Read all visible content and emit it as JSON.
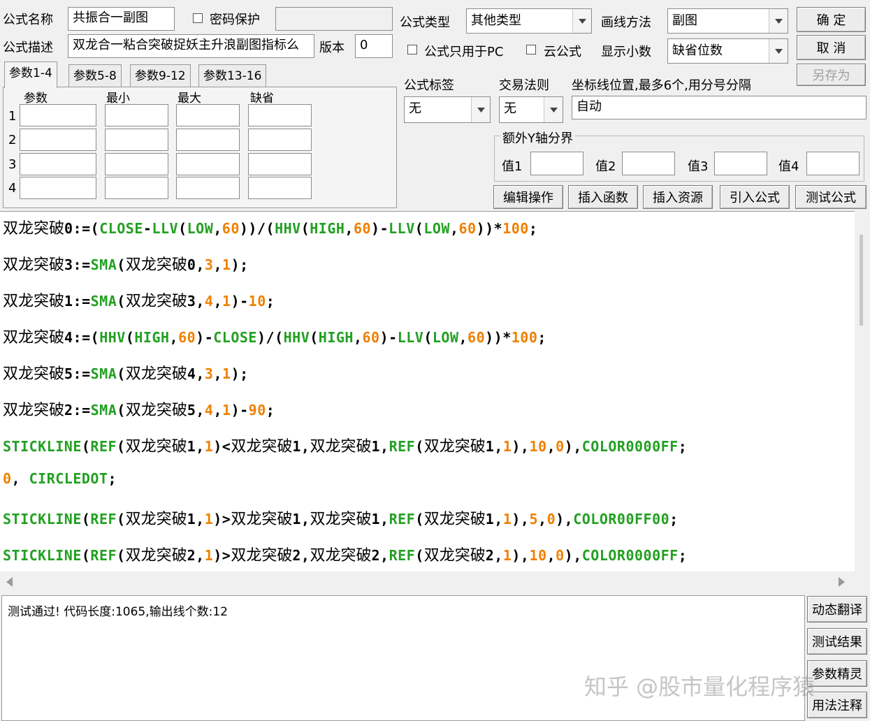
{
  "header": {
    "name_label": "公式名称",
    "name_value": "共振合一副图",
    "password_label": "密码保护",
    "desc_label": "公式描述",
    "desc_value": "双龙合一粘合突破捉妖主升浪副图指标么",
    "version_label": "版本",
    "version_value": "0",
    "type_label": "公式类型",
    "type_value": "其他类型",
    "draw_label": "画线方法",
    "draw_value": "副图",
    "pc_only_label": "公式只用于PC",
    "cloud_label": "云公式",
    "decimals_label": "显示小数",
    "decimals_value": "缺省位数"
  },
  "buttons": {
    "ok": "确  定",
    "cancel": "取  消",
    "save_as": "另存为"
  },
  "tabs": [
    "参数1-4",
    "参数5-8",
    "参数9-12",
    "参数13-16"
  ],
  "params": {
    "headers": [
      "参数",
      "最小",
      "最大",
      "缺省"
    ],
    "rows": [
      "1",
      "2",
      "3",
      "4"
    ]
  },
  "options": {
    "tag_label": "公式标签",
    "tag_value": "无",
    "trade_label": "交易法则",
    "trade_value": "无",
    "coord_label": "坐标线位置,最多6个,用分号分隔",
    "coord_value": "自动",
    "extra_y_label": "额外Y轴分界",
    "val1": "值1",
    "val2": "值2",
    "val3": "值3",
    "val4": "值4"
  },
  "toolbar": [
    "编辑操作",
    "插入函数",
    "插入资源",
    "引入公式",
    "测试公式"
  ],
  "code_lines": [
    [
      [
        "cn",
        "双龙突破"
      ],
      [
        "t",
        "0:=("
      ],
      [
        "f",
        "CLOSE"
      ],
      [
        "t",
        "-"
      ],
      [
        "f",
        "LLV"
      ],
      [
        "t",
        "("
      ],
      [
        "f",
        "LOW"
      ],
      [
        "t",
        ","
      ],
      [
        "n",
        "60"
      ],
      [
        "t",
        "))/("
      ],
      [
        "f",
        "HHV"
      ],
      [
        "t",
        "("
      ],
      [
        "f",
        "HIGH"
      ],
      [
        "t",
        ","
      ],
      [
        "n",
        "60"
      ],
      [
        "t",
        ")-"
      ],
      [
        "f",
        "LLV"
      ],
      [
        "t",
        "("
      ],
      [
        "f",
        "LOW"
      ],
      [
        "t",
        ","
      ],
      [
        "n",
        "60"
      ],
      [
        "t",
        "))*"
      ],
      [
        "n",
        "100"
      ],
      [
        "t",
        ";"
      ]
    ],
    [
      [
        "cn",
        "双龙突破"
      ],
      [
        "t",
        "3:="
      ],
      [
        "f",
        "SMA"
      ],
      [
        "t",
        "("
      ],
      [
        "cn",
        "双龙突破"
      ],
      [
        "t",
        "0,"
      ],
      [
        "n",
        "3"
      ],
      [
        "t",
        ","
      ],
      [
        "n",
        "1"
      ],
      [
        "t",
        ");"
      ]
    ],
    [
      [
        "cn",
        "双龙突破"
      ],
      [
        "t",
        "1:="
      ],
      [
        "f",
        "SMA"
      ],
      [
        "t",
        "("
      ],
      [
        "cn",
        "双龙突破"
      ],
      [
        "t",
        "3,"
      ],
      [
        "n",
        "4"
      ],
      [
        "t",
        ","
      ],
      [
        "n",
        "1"
      ],
      [
        "t",
        ")-"
      ],
      [
        "n",
        "10"
      ],
      [
        "t",
        ";"
      ]
    ],
    [
      [
        "cn",
        "双龙突破"
      ],
      [
        "t",
        "4:=("
      ],
      [
        "f",
        "HHV"
      ],
      [
        "t",
        "("
      ],
      [
        "f",
        "HIGH"
      ],
      [
        "t",
        ","
      ],
      [
        "n",
        "60"
      ],
      [
        "t",
        ")-"
      ],
      [
        "f",
        "CLOSE"
      ],
      [
        "t",
        ")/("
      ],
      [
        "f",
        "HHV"
      ],
      [
        "t",
        "("
      ],
      [
        "f",
        "HIGH"
      ],
      [
        "t",
        ","
      ],
      [
        "n",
        "60"
      ],
      [
        "t",
        ")-"
      ],
      [
        "f",
        "LLV"
      ],
      [
        "t",
        "("
      ],
      [
        "f",
        "LOW"
      ],
      [
        "t",
        ","
      ],
      [
        "n",
        "60"
      ],
      [
        "t",
        "))*"
      ],
      [
        "n",
        "100"
      ],
      [
        "t",
        ";"
      ]
    ],
    [
      [
        "cn",
        "双龙突破"
      ],
      [
        "t",
        "5:="
      ],
      [
        "f",
        "SMA"
      ],
      [
        "t",
        "("
      ],
      [
        "cn",
        "双龙突破"
      ],
      [
        "t",
        "4,"
      ],
      [
        "n",
        "3"
      ],
      [
        "t",
        ","
      ],
      [
        "n",
        "1"
      ],
      [
        "t",
        ");"
      ]
    ],
    [
      [
        "cn",
        "双龙突破"
      ],
      [
        "t",
        "2:="
      ],
      [
        "f",
        "SMA"
      ],
      [
        "t",
        "("
      ],
      [
        "cn",
        "双龙突破"
      ],
      [
        "t",
        "5,"
      ],
      [
        "n",
        "4"
      ],
      [
        "t",
        ","
      ],
      [
        "n",
        "1"
      ],
      [
        "t",
        ")-"
      ],
      [
        "n",
        "90"
      ],
      [
        "t",
        ";"
      ]
    ],
    [
      [
        "f",
        "STICKLINE"
      ],
      [
        "t",
        "("
      ],
      [
        "f",
        "REF"
      ],
      [
        "t",
        "("
      ],
      [
        "cn",
        "双龙突破"
      ],
      [
        "t",
        "1,"
      ],
      [
        "n",
        "1"
      ],
      [
        "t",
        ")<"
      ],
      [
        "cn",
        "双龙突破"
      ],
      [
        "t",
        "1,"
      ],
      [
        "cn",
        "双龙突破"
      ],
      [
        "t",
        "1,"
      ],
      [
        "f",
        "REF"
      ],
      [
        "t",
        "("
      ],
      [
        "cn",
        "双龙突破"
      ],
      [
        "t",
        "1,"
      ],
      [
        "n",
        "1"
      ],
      [
        "t",
        "),"
      ],
      [
        "n",
        "10"
      ],
      [
        "t",
        ","
      ],
      [
        "n",
        "0"
      ],
      [
        "t",
        "),"
      ],
      [
        "f",
        "COLOR0000FF"
      ],
      [
        "t",
        ";"
      ]
    ],
    [
      [
        "n",
        "0"
      ],
      [
        "t",
        ", "
      ],
      [
        "f",
        "CIRCLEDOT"
      ],
      [
        "t",
        ";"
      ]
    ],
    [
      [
        "f",
        "STICKLINE"
      ],
      [
        "t",
        "("
      ],
      [
        "f",
        "REF"
      ],
      [
        "t",
        "("
      ],
      [
        "cn",
        "双龙突破"
      ],
      [
        "t",
        "1,"
      ],
      [
        "n",
        "1"
      ],
      [
        "t",
        ")>"
      ],
      [
        "cn",
        "双龙突破"
      ],
      [
        "t",
        "1,"
      ],
      [
        "cn",
        "双龙突破"
      ],
      [
        "t",
        "1,"
      ],
      [
        "f",
        "REF"
      ],
      [
        "t",
        "("
      ],
      [
        "cn",
        "双龙突破"
      ],
      [
        "t",
        "1,"
      ],
      [
        "n",
        "1"
      ],
      [
        "t",
        "),"
      ],
      [
        "n",
        "5"
      ],
      [
        "t",
        ","
      ],
      [
        "n",
        "0"
      ],
      [
        "t",
        "),"
      ],
      [
        "f",
        "COLOR00FF00"
      ],
      [
        "t",
        ";"
      ]
    ],
    [
      [
        "f",
        "STICKLINE"
      ],
      [
        "t",
        "("
      ],
      [
        "f",
        "REF"
      ],
      [
        "t",
        "("
      ],
      [
        "cn",
        "双龙突破"
      ],
      [
        "t",
        "2,"
      ],
      [
        "n",
        "1"
      ],
      [
        "t",
        ")>"
      ],
      [
        "cn",
        "双龙突破"
      ],
      [
        "t",
        "2,"
      ],
      [
        "cn",
        "双龙突破"
      ],
      [
        "t",
        "2,"
      ],
      [
        "f",
        "REF"
      ],
      [
        "t",
        "("
      ],
      [
        "cn",
        "双龙突破"
      ],
      [
        "t",
        "2,"
      ],
      [
        "n",
        "1"
      ],
      [
        "t",
        "),"
      ],
      [
        "n",
        "10"
      ],
      [
        "t",
        ","
      ],
      [
        "n",
        "0"
      ],
      [
        "t",
        "),"
      ],
      [
        "f",
        "COLOR0000FF"
      ],
      [
        "t",
        ";"
      ]
    ]
  ],
  "status_text": "测试通过! 代码长度:1065,输出线个数:12",
  "side_buttons": [
    "动态翻译",
    "测试结果",
    "参数精灵",
    "用法注释"
  ],
  "watermark": "知乎 @股市量化程序猿"
}
